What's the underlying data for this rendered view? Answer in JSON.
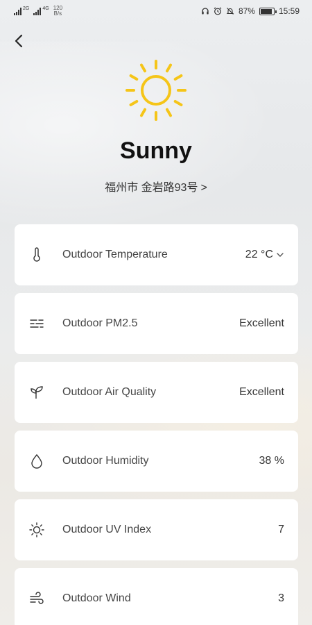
{
  "status_bar": {
    "signal1_label": "2G",
    "signal2_label": "4G",
    "net_speed_value": "120",
    "net_speed_unit": "B/s",
    "battery": "87%",
    "battery_level": 0.87,
    "time": "15:59"
  },
  "weather": {
    "condition": "Sunny",
    "location": "福州市 金岩路93号",
    "location_chevron": ">",
    "sun_color": "#F5C518"
  },
  "cards": [
    {
      "icon": "thermometer-icon",
      "label": "Outdoor Temperature",
      "value": "22 °C"
    },
    {
      "icon": "pm25-icon",
      "label": "Outdoor PM2.5",
      "value": "Excellent"
    },
    {
      "icon": "leaf-icon",
      "label": "Outdoor Air Quality",
      "value": "Excellent"
    },
    {
      "icon": "water-drop-icon",
      "label": "Outdoor Humidity",
      "value": "38 %"
    },
    {
      "icon": "sun-small-icon",
      "label": "Outdoor UV Index",
      "value": "7"
    },
    {
      "icon": "wind-icon",
      "label": "Outdoor Wind",
      "value": "3"
    }
  ]
}
